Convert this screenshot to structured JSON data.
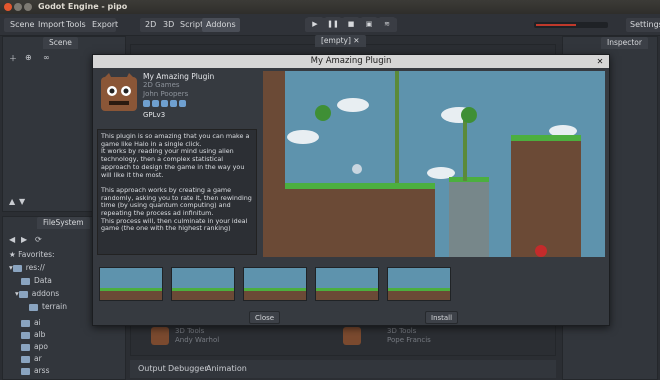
{
  "window": {
    "title": "Godot Engine - pipo"
  },
  "menu": {
    "scene": "Scene",
    "import": "Import",
    "tools": "Tools",
    "export": "Export"
  },
  "workspace": {
    "d2": "2D",
    "d3": "3D",
    "script": "Script",
    "addons": "Addons"
  },
  "settings": "Settings",
  "scene_tab": "Scene",
  "inspector_tab": "Inspector",
  "empty_tab": "[empty]",
  "filesystem": {
    "tab": "FileSystem",
    "favorites": "Favorites:",
    "items": [
      "res://",
      "Data",
      "addons",
      "terrain",
      "ai",
      "alb",
      "apo",
      "ar",
      "arss"
    ]
  },
  "bottom_tabs": {
    "output": "Output",
    "debugger": "Debugger",
    "animation": "Animation"
  },
  "bg_assets": [
    {
      "category": "3D Tools",
      "author": "Andy Warhol"
    },
    {
      "category": "3D Tools",
      "author": "Pope Francis"
    }
  ],
  "dialog": {
    "title": "My Amazing Plugin",
    "name": "My Amazing Plugin",
    "category": "2D Games",
    "author": "John Poopers",
    "license": "GPLv3",
    "rating": 5,
    "description": "This plugin is so amazing that you can make a game like Halo in a single click.\nIt works by reading your mind using alien technology, then a complex statistical approach to design the game in the way you will like it the most.\n\nThis approach works by creating a game randomly, asking you to rate it, then rewinding time (by using quantum computing) and repeating the process ad infinitum.\nThis process will, then culminate in your ideal game (the one with the highest ranking)",
    "close": "Close",
    "install": "Install"
  }
}
